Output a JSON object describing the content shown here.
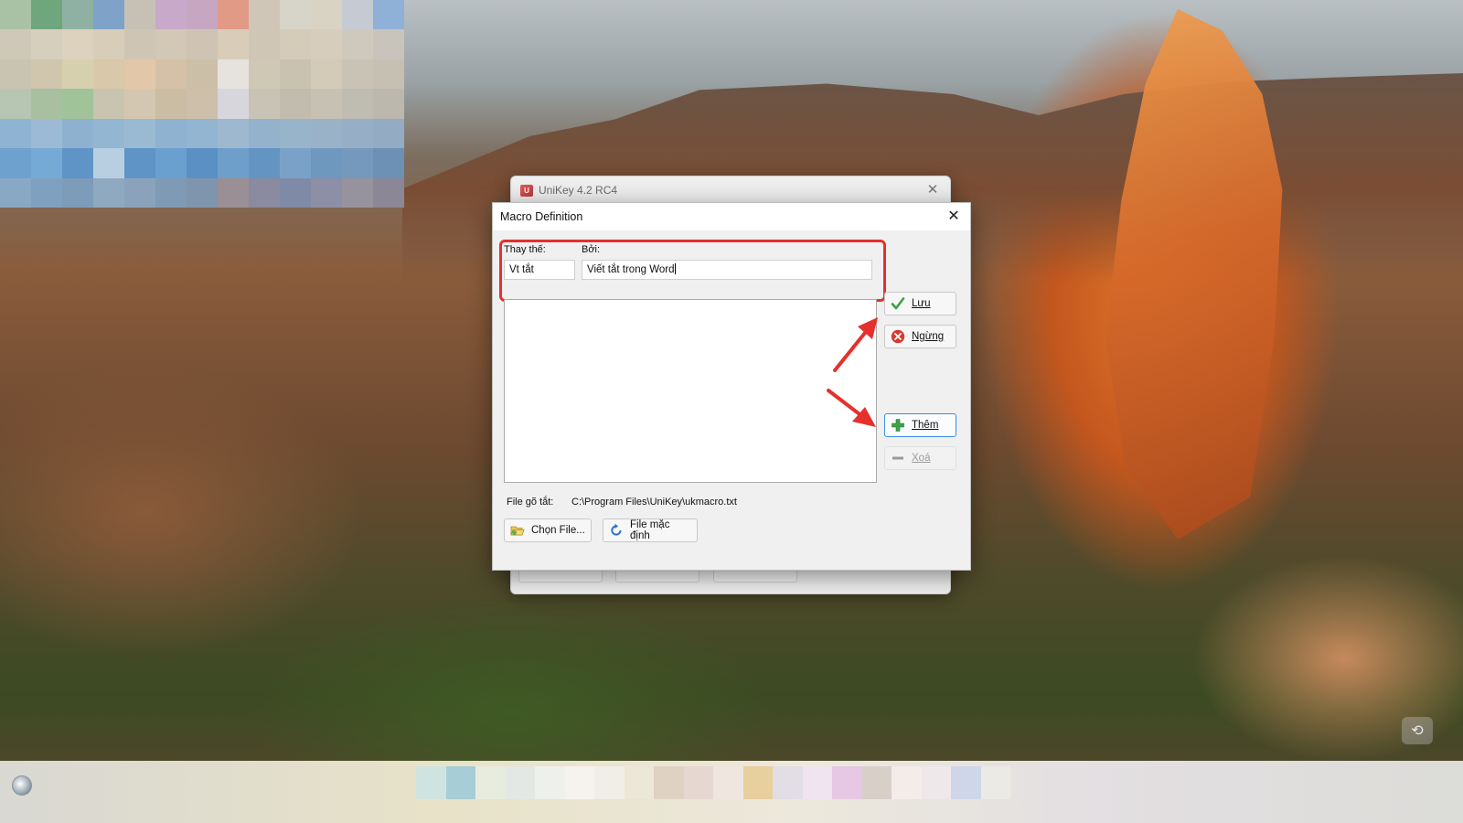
{
  "unikey_window": {
    "title": "UniKey 4.2 RC4"
  },
  "dialog": {
    "title": "Macro Definition",
    "replace_label": "Thay thế:",
    "replace_value": "Vt tắt",
    "by_label": "Bởi:",
    "by_value": "Viết tắt trong Word",
    "buttons": {
      "save": "Lưu",
      "stop": "Ngừng",
      "add": "Thêm",
      "delete": "Xoá"
    },
    "file_label": "File gõ tắt:",
    "file_path": "C:\\Program Files\\UniKey\\ukmacro.txt",
    "choose_file": "Chọn File...",
    "default_file": "File mặc định"
  },
  "colors": {
    "annotation_red": "#e5302d",
    "default_button_border": "#3a8ee6",
    "check_green": "#3aa34a",
    "stop_red": "#d83a2e"
  },
  "icons": [
    "unikey-logo-icon",
    "close-icon",
    "checkmark-icon",
    "stop-icon",
    "plus-icon",
    "minus-icon",
    "folder-open-icon",
    "reset-icon",
    "start-orb-icon"
  ]
}
